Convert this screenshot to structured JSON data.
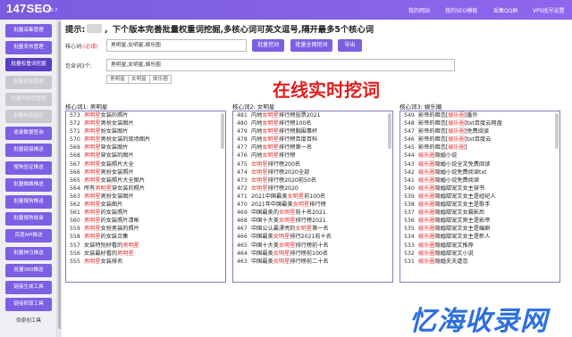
{
  "header": {
    "logo": "147SEO",
    "version": "v1.3.0.7",
    "nav": [
      "我的网站",
      "我的SEO模板",
      "采集QQ群",
      "VPS抵号设置"
    ]
  },
  "sidebar": {
    "items": [
      {
        "label": "批量采集管理",
        "state": "normal"
      },
      {
        "label": "批量发布管理",
        "state": "normal"
      },
      {
        "label": "批量权重词挖掘",
        "state": "active"
      },
      {
        "label": "批量替换管理",
        "state": "disabled"
      },
      {
        "label": "批量伪原创管理",
        "state": "disabled"
      },
      {
        "label": "批量标签监控",
        "state": "disabled"
      },
      {
        "label": "收录数据查询",
        "state": "normal"
      },
      {
        "label": "批量链接推送",
        "state": "normal"
      },
      {
        "label": "搜狗验证推送",
        "state": "normal"
      },
      {
        "label": "批量蜘蛛推送",
        "state": "normal"
      },
      {
        "label": "批量搜狗推送",
        "state": "normal"
      },
      {
        "label": "批量搜狗收录",
        "state": "normal"
      },
      {
        "label": "百度API推送",
        "state": "normal"
      },
      {
        "label": "批量神马推送",
        "state": "normal"
      },
      {
        "label": "批量360推送",
        "state": "normal"
      },
      {
        "label": "链接生成工具",
        "state": "normal"
      },
      {
        "label": "链接抓取工具",
        "state": "normal"
      },
      {
        "label": "伪原创工具",
        "state": "plain"
      }
    ]
  },
  "hint": {
    "prefix": "提示:",
    "text": "，下个版本完善批量权重词挖掘,多核心词可英文逗号,隔开最多5个核心词"
  },
  "form": {
    "core_label": "核心词:",
    "core_required": "(必填)",
    "core_value": "男明星,女明星,娱乐圈",
    "btn_start": "批量挖词",
    "btn_all": "批量全网挖词",
    "btn_export": "导出",
    "include_label": "包含词3个:",
    "include_value": "男明星,女明星,娱乐圈",
    "tags": [
      "男明星",
      "女明星",
      "娱乐圈"
    ]
  },
  "banner": "在线实时挖词",
  "columns": [
    {
      "title": "核心词1: 男明星",
      "highlight": "男明星",
      "rows": [
        {
          "n": "573",
          "t": "男明星女装的照片"
        },
        {
          "n": "572",
          "t": "男明星男扮女装图片"
        },
        {
          "n": "571",
          "t": "男明星扮女装图片"
        },
        {
          "n": "570",
          "t": "男明星男扮女装的现场图片"
        },
        {
          "n": "569",
          "t": "男明星穿女装图片"
        },
        {
          "n": "568",
          "t": "男明星穿女装的图片"
        },
        {
          "n": "567",
          "t": "男明星女装照片大全"
        },
        {
          "n": "566",
          "t": "男明星男扮女装照片"
        },
        {
          "n": "565",
          "t": "男明星女装照片大全图片"
        },
        {
          "n": "564",
          "t": "所有男明星穿女装的照片"
        },
        {
          "n": "563",
          "t": "男明星男扮女装图片"
        },
        {
          "n": "562",
          "t": "男明星女装图片"
        },
        {
          "n": "561",
          "t": "男明星的女装照片"
        },
        {
          "n": "560",
          "t": "男明星的女装照片清晰"
        },
        {
          "n": "559",
          "t": "男明星女扮男装的照片"
        },
        {
          "n": "558",
          "t": "男明星的女装合集"
        },
        {
          "n": "557",
          "t": "女装特别好看的男明星"
        },
        {
          "n": "556",
          "t": "女装最好看的男明星"
        },
        {
          "n": "555",
          "t": "男明星女装排名"
        }
      ]
    },
    {
      "title": "核心词2: 女明星",
      "highlight": "女明星",
      "rows": [
        {
          "n": "481",
          "t": "内地女明星排行榜投票2021"
        },
        {
          "n": "480",
          "t": "内地女明星排行榜100名"
        },
        {
          "n": "479",
          "t": "内地女明星排行榜胸围事杯"
        },
        {
          "n": "478",
          "t": "内地女明星排行榜百度百科"
        },
        {
          "n": "477",
          "t": "内地女明星排行榜第一名"
        },
        {
          "n": "476",
          "t": "内地女明星排行榜"
        },
        {
          "n": "475",
          "t": "女明星排行榜200名"
        },
        {
          "n": "474",
          "t": "女明星排行榜2020全部"
        },
        {
          "n": "473",
          "t": "女明星排行榜2020前50名"
        },
        {
          "n": "472",
          "t": "女明星排行榜2020"
        },
        {
          "n": "471",
          "t": "2021中国最美女明星前100名"
        },
        {
          "n": "470",
          "t": "2021年中国最美女明星排行榜"
        },
        {
          "n": "469",
          "t": "中国最美的女明星前十名2021"
        },
        {
          "n": "468",
          "t": "中国十大美女明星排行榜2021"
        },
        {
          "n": "467",
          "t": "中国公认最漂亮的女明星第一名"
        },
        {
          "n": "466",
          "t": "中国最美女明星排行2021前十名"
        },
        {
          "n": "465",
          "t": "中国十大美女明星排行榜前十名"
        },
        {
          "n": "464",
          "t": "中国最美女明星排行榜前100名"
        },
        {
          "n": "463",
          "t": "中国最美女明星排行榜前二十名"
        }
      ]
    },
    {
      "title": "核心词3: 娱乐圈",
      "highlight": "娱乐圈",
      "rows": [
        {
          "n": "549",
          "t": "影帝的暗恋[娱乐圈]番外"
        },
        {
          "n": "548",
          "t": "影帝的暗恋[娱乐圈]txt百度云网盘"
        },
        {
          "n": "547",
          "t": "影帝的暗恋[娱乐圈]免费阅读"
        },
        {
          "n": "546",
          "t": "影帝的暗恋[娱乐圈]txt百度云"
        },
        {
          "n": "545",
          "t": "影帝的暗恋[娱乐圈]"
        },
        {
          "n": "544",
          "t": "娱乐圈隐婚小说"
        },
        {
          "n": "543",
          "t": "娱乐圈隐婚小说全文免费阅读"
        },
        {
          "n": "542",
          "t": "娱乐圈隐婚小说免费阅读txt"
        },
        {
          "n": "541",
          "t": "娱乐圈隐婚小说免费阅读"
        },
        {
          "n": "540",
          "t": "娱乐圈隐婚甜宠文女主穿书"
        },
        {
          "n": "539",
          "t": "娱乐圈隐婚甜宠文女主是经纪人"
        },
        {
          "n": "538",
          "t": "娱乐圈隐婚甜宠文女主是歌手"
        },
        {
          "n": "537",
          "t": "娱乐圈隐婚甜宠文女霸影后"
        },
        {
          "n": "536",
          "t": "娱乐圈隐婚甜宠文男主是影帝"
        },
        {
          "n": "535",
          "t": "娱乐圈隐婚甜宠文女主是编剧"
        },
        {
          "n": "534",
          "t": "娱乐圈隐婚甜宠文女主是新人"
        },
        {
          "n": "533",
          "t": "娱乐圈隐婚甜宠文推荐"
        },
        {
          "n": "532",
          "t": "娱乐圈隐婚甜宠文小说"
        },
        {
          "n": "531",
          "t": "娱乐圈隐婚夫夫虐恋"
        }
      ]
    }
  ],
  "watermark": "忆海收录网"
}
